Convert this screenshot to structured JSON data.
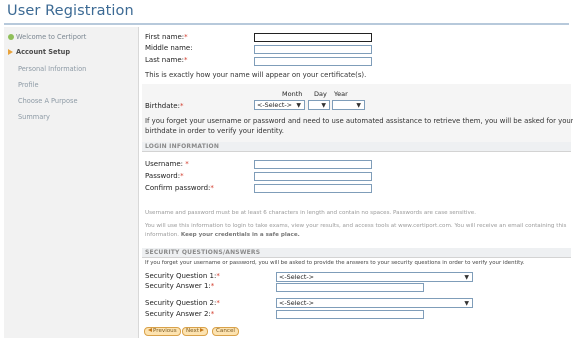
{
  "page": {
    "title": "User Registration"
  },
  "sidebar": {
    "items": [
      {
        "label": "Welcome to Certiport",
        "state": "done"
      },
      {
        "label": "Account Setup",
        "state": "active"
      },
      {
        "label": "Personal Information",
        "state": "pending"
      },
      {
        "label": "Profile",
        "state": "pending"
      },
      {
        "label": "Choose A Purpose",
        "state": "pending"
      },
      {
        "label": "Summary",
        "state": "pending"
      }
    ]
  },
  "name": {
    "first_label": "First name:",
    "middle_label": "Middle name:",
    "last_label": "Last name:",
    "required_mark": "*",
    "note": "This is exactly how your name will appear on your certificate(s)."
  },
  "birthdate": {
    "label": "Birthdate:",
    "month_header": "Month",
    "day_header": "Day",
    "year_header": "Year",
    "month_value": "<-Select->",
    "day_value": "",
    "year_value": "",
    "note_line1": "If you forget your username or password and need to use automated assistance to retrieve them, you will be asked for your",
    "note_line2": "birthdate in order to verify your identity."
  },
  "login": {
    "heading": "LOGIN INFORMATION",
    "username_label": "Username:",
    "password_label": "Password:",
    "confirm_label": "Confirm password:",
    "note1": "Username and password must be at least 6 characters in length and contain no spaces. Passwords are case sensitive.",
    "note2_line1": "You will use this information to login to take exams, view your results, and access tools at www.certiport.com. You will receive an email containing this",
    "note2_line2_a": "information. ",
    "note2_line2_b": "Keep your credentials in a safe place."
  },
  "security": {
    "heading": "SECURITY QUESTIONS/ANSWERS",
    "note": "If you forget your username or password, you will be asked to provide the answers to your security questions in order to verify your identity.",
    "q1_label": "Security Question 1:",
    "a1_label": "Security Answer 1:",
    "q2_label": "Security Question 2:",
    "a2_label": "Security Answer 2:",
    "q1_value": "<-Select->",
    "q2_value": "<-Select->"
  },
  "buttons": {
    "previous": "Previous",
    "next": "Next",
    "cancel": "Cancel"
  },
  "colors": {
    "title": "#3c6a94",
    "required": "#d23a2a",
    "button_bg": "#fde3b0",
    "button_border": "#d9a24a"
  }
}
